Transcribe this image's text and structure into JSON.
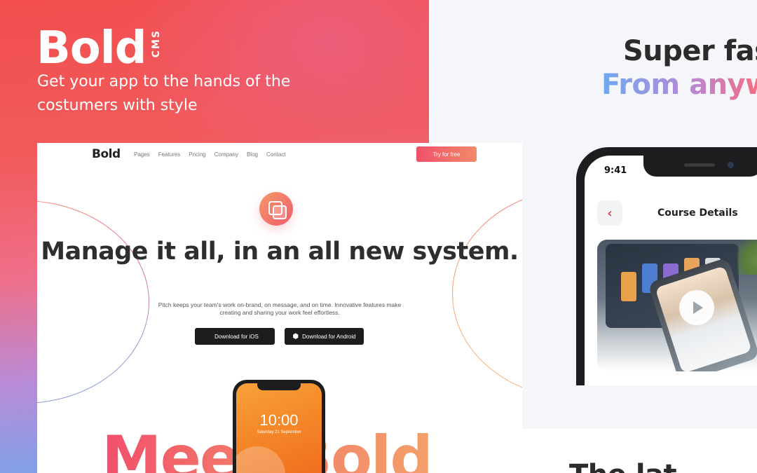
{
  "brand": {
    "word": "Bold",
    "suffix": "CMS"
  },
  "hero": {
    "tagline": "Get your app to the hands of the costumers with style"
  },
  "right": {
    "headline_1": "Super fast",
    "headline_2": "From anywa",
    "bottom_peek": "The lat"
  },
  "mobile_app": {
    "status_time": "9:41",
    "back_icon": "chevron-left-icon",
    "title": "Course Details",
    "play_icon": "play-icon"
  },
  "website": {
    "logo": "Bold",
    "nav": [
      "Pages",
      "Features",
      "Pricing",
      "Company",
      "Blog",
      "Contact"
    ],
    "cta": "Try for free",
    "badge_icon": "layers-icon",
    "headline": "Manage it all, in an all new system.",
    "subtext": "Pitch keeps your team's work on-brand, on message, and on time. Innovative features make creating and sharing your work feel effortless.",
    "btn_ios": "Download for iOS",
    "btn_android": "Download for Android",
    "ios_icon": "apple-icon",
    "android_icon": "android-icon",
    "meet_text": "Meet Bold",
    "phone_time": "10:00",
    "phone_date": "Saturday 21 September"
  },
  "colors": {
    "accent_red": "#f24e4e",
    "accent_orange": "#f3a06a",
    "accent_blue": "#6ea8ef",
    "dark": "#1d1d1f"
  }
}
